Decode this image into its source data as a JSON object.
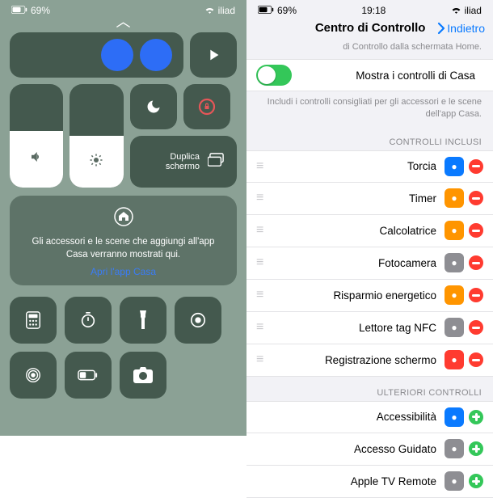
{
  "cc": {
    "status": {
      "carrier": "iliad",
      "battery_pct": "69%",
      "wifi_icon": "wifi-icon",
      "battery_icon": "battery-icon"
    },
    "screen_mirror": "Duplica schermo",
    "home": {
      "text": "Gli accessori e le scene che aggiungi all'app Casa verranno mostrati qui.",
      "link": "Apri l'app Casa"
    }
  },
  "st": {
    "status": {
      "carrier": "iliad",
      "time": "19:18",
      "battery_pct": "69%"
    },
    "back": "Indietro",
    "title": "Centro di Controllo",
    "subtitle_top": "di Controllo dalla schermata Home.",
    "show_home": {
      "label": "Mostra i controlli di Casa",
      "on": true
    },
    "show_home_sub": "Includi i controlli consigliati per gli accessori e le scene dell'app Casa.",
    "section_included": "CONTROLLI INCLUSI",
    "included": [
      {
        "label": "Torcia",
        "color": "blue"
      },
      {
        "label": "Timer",
        "color": "orange"
      },
      {
        "label": "Calcolatrice",
        "color": "orange"
      },
      {
        "label": "Fotocamera",
        "color": "gray"
      },
      {
        "label": "Risparmio energetico",
        "color": "orange"
      },
      {
        "label": "Lettore tag NFC",
        "color": "gray"
      },
      {
        "label": "Registrazione schermo",
        "color": "red"
      }
    ],
    "section_more": "ULTERIORI CONTROLLI",
    "more": [
      {
        "label": "Accessibilità",
        "color": "blue"
      },
      {
        "label": "Accesso Guidato",
        "color": "gray"
      },
      {
        "label": "Apple TV Remote",
        "color": "gray"
      }
    ]
  }
}
